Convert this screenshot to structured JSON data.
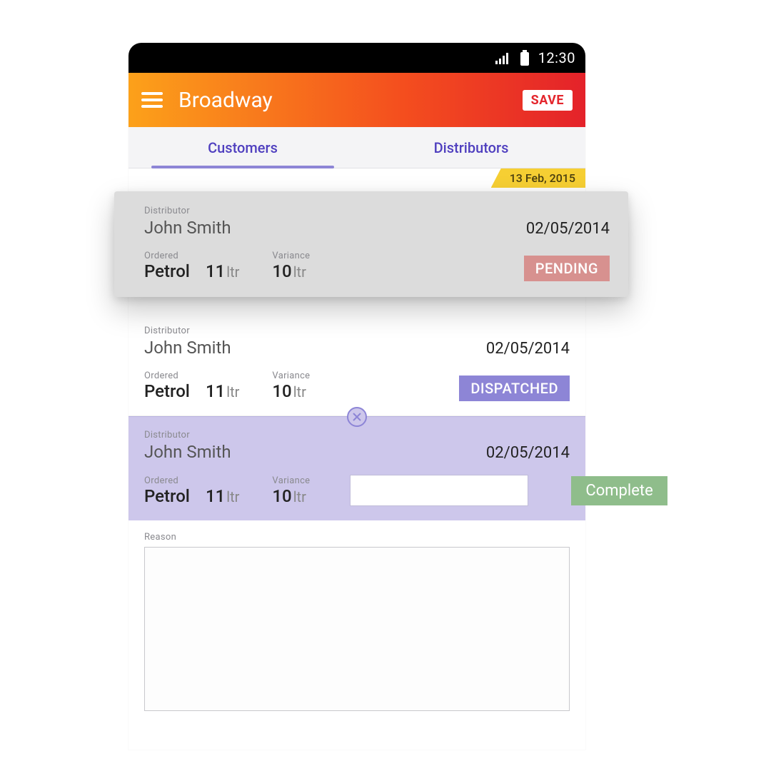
{
  "statusbar": {
    "time": "12:30"
  },
  "appbar": {
    "title": "Broadway",
    "save_label": "SAVE"
  },
  "tabs": {
    "customers": "Customers",
    "distributors": "Distributors"
  },
  "date_ribbon": "13 Feb, 2015",
  "labels": {
    "distributor": "Distributor",
    "ordered": "Ordered",
    "variance": "Variance",
    "reason": "Reason"
  },
  "units": {
    "ltr": "ltr"
  },
  "cards": [
    {
      "distributor": "John Smith",
      "date": "02/05/2014",
      "ordered_product": "Petrol",
      "ordered_qty": "11",
      "variance_qty": "10",
      "status": "PENDING"
    },
    {
      "distributor": "John Smith",
      "date": "02/05/2014",
      "ordered_product": "Petrol",
      "ordered_qty": "11",
      "variance_qty": "10",
      "status": "DISPATCHED"
    },
    {
      "distributor": "John Smith",
      "date": "02/05/2014",
      "ordered_product": "Petrol",
      "ordered_qty": "11",
      "variance_qty": "10",
      "complete_label": "Complete",
      "input_value": "",
      "reason_value": ""
    }
  ]
}
